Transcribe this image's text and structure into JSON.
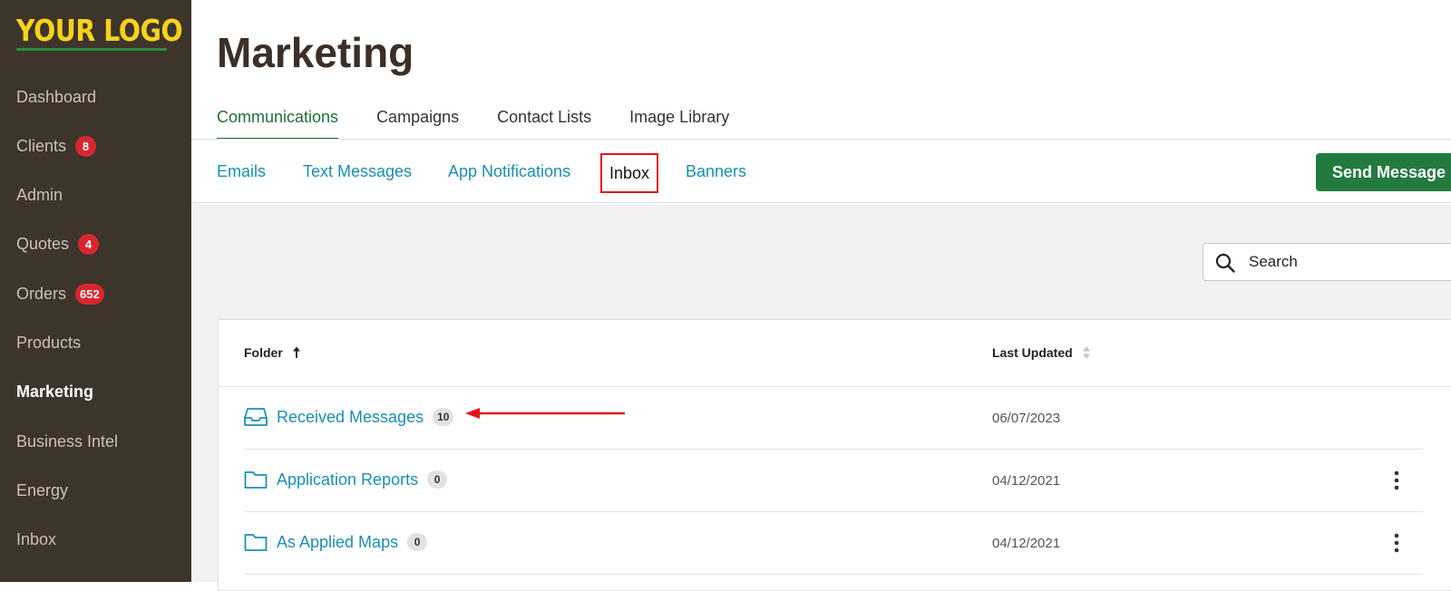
{
  "brand": {
    "logo_text": "YOUR LOGO"
  },
  "sidebar": {
    "items": [
      {
        "label": "Dashboard",
        "badge": ""
      },
      {
        "label": "Clients",
        "badge": "8"
      },
      {
        "label": "Admin",
        "badge": ""
      },
      {
        "label": "Quotes",
        "badge": "4"
      },
      {
        "label": "Orders",
        "badge": "652"
      },
      {
        "label": "Products",
        "badge": ""
      },
      {
        "label": "Marketing",
        "badge": "",
        "active": true
      },
      {
        "label": "Business Intel",
        "badge": ""
      },
      {
        "label": "Energy",
        "badge": ""
      },
      {
        "label": "Inbox",
        "badge": ""
      }
    ]
  },
  "header": {
    "title": "Marketing"
  },
  "tabs": [
    {
      "label": "Communications",
      "active": true
    },
    {
      "label": "Campaigns"
    },
    {
      "label": "Contact Lists"
    },
    {
      "label": "Image Library"
    }
  ],
  "subtabs": [
    {
      "label": "Emails"
    },
    {
      "label": "Text Messages"
    },
    {
      "label": "App Notifications"
    },
    {
      "label": "Inbox",
      "active": true
    },
    {
      "label": "Banners"
    }
  ],
  "actions": {
    "send_message": "Send Message"
  },
  "search": {
    "placeholder": "Search"
  },
  "table": {
    "columns": {
      "folder": "Folder",
      "last_updated": "Last Updated"
    },
    "rows": [
      {
        "icon": "inbox-tray-icon",
        "name": "Received Messages",
        "count": "10",
        "date": "06/07/2023",
        "menu": false
      },
      {
        "icon": "folder-icon",
        "name": "Application Reports",
        "count": "0",
        "date": "04/12/2021",
        "menu": true
      },
      {
        "icon": "folder-icon",
        "name": "As Applied Maps",
        "count": "0",
        "date": "04/12/2021",
        "menu": true
      }
    ]
  },
  "colors": {
    "sidebar_bg": "#3d342b",
    "logo": "#f7d21c",
    "accent_green": "#237a3f",
    "link_blue": "#1a8fb3",
    "badge_red": "#d9262c",
    "highlight_red": "#e3141b"
  }
}
